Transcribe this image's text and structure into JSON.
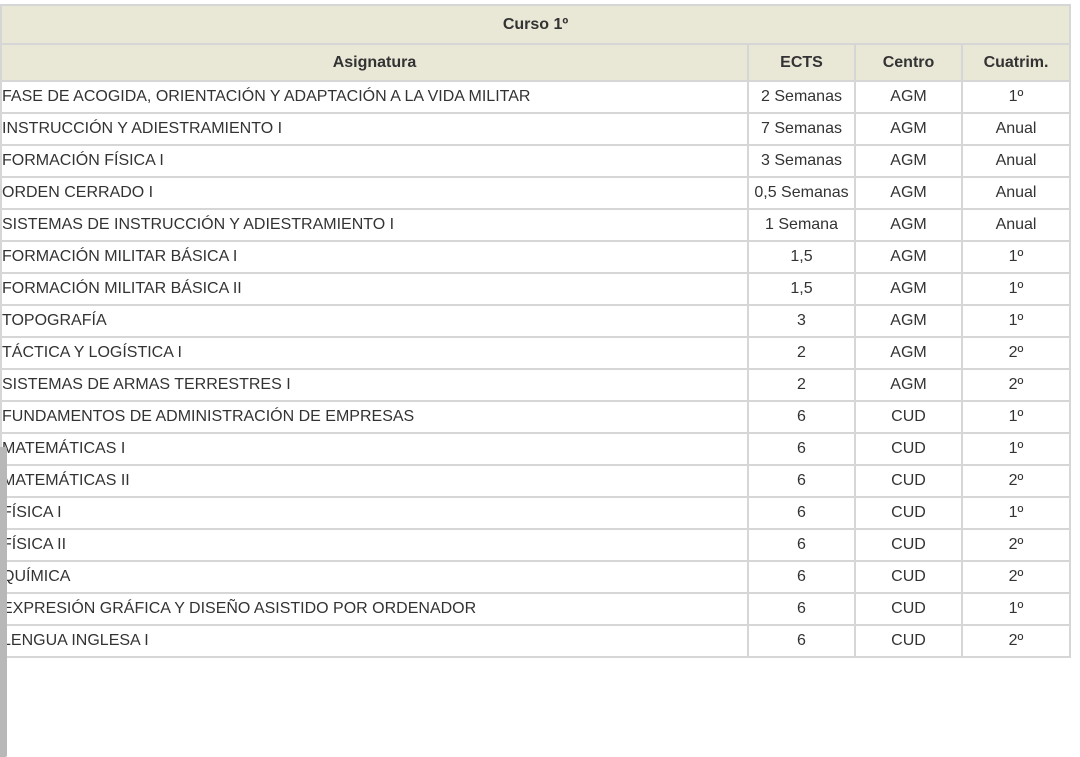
{
  "table": {
    "course_title": "Curso 1º",
    "columns": [
      "Asignatura",
      "ECTS",
      "Centro",
      "Cuatrim."
    ],
    "rows": [
      [
        "FASE DE ACOGIDA, ORIENTACIÓN Y ADAPTACIÓN A LA VIDA MILITAR",
        "2 Semanas",
        "AGM",
        "1º"
      ],
      [
        "INSTRUCCIÓN Y ADIESTRAMIENTO I",
        "7 Semanas",
        "AGM",
        "Anual"
      ],
      [
        "FORMACIÓN FÍSICA I",
        "3 Semanas",
        "AGM",
        "Anual"
      ],
      [
        "ORDEN CERRADO I",
        "0,5 Semanas",
        "AGM",
        "Anual"
      ],
      [
        "SISTEMAS DE INSTRUCCIÓN Y ADIESTRAMIENTO I",
        "1 Semana",
        "AGM",
        "Anual"
      ],
      [
        "FORMACIÓN MILITAR BÁSICA I",
        "1,5",
        "AGM",
        "1º"
      ],
      [
        "FORMACIÓN MILITAR BÁSICA II",
        "1,5",
        "AGM",
        "1º"
      ],
      [
        "TOPOGRAFÍA",
        "3",
        "AGM",
        "1º"
      ],
      [
        "TÁCTICA Y LOGÍSTICA I",
        "2",
        "AGM",
        "2º"
      ],
      [
        "SISTEMAS DE ARMAS TERRESTRES I",
        "2",
        "AGM",
        "2º"
      ],
      [
        "FUNDAMENTOS DE ADMINISTRACIÓN DE EMPRESAS",
        "6",
        "CUD",
        "1º"
      ],
      [
        "MATEMÁTICAS I",
        "6",
        "CUD",
        "1º"
      ],
      [
        "MATEMÁTICAS II",
        "6",
        "CUD",
        "2º"
      ],
      [
        "FÍSICA I",
        "6",
        "CUD",
        "1º"
      ],
      [
        "FÍSICA II",
        "6",
        "CUD",
        "2º"
      ],
      [
        "QUÍMICA",
        "6",
        "CUD",
        "2º"
      ],
      [
        "EXPRESIÓN GRÁFICA Y DISEÑO ASISTIDO POR ORDENADOR",
        "6",
        "CUD",
        "1º"
      ],
      [
        "LENGUA INGLESA I",
        "6",
        "CUD",
        "2º"
      ]
    ]
  },
  "colors": {
    "header_bg": "#e9e7d6",
    "border": "#d6d6d6",
    "text": "#333333"
  }
}
